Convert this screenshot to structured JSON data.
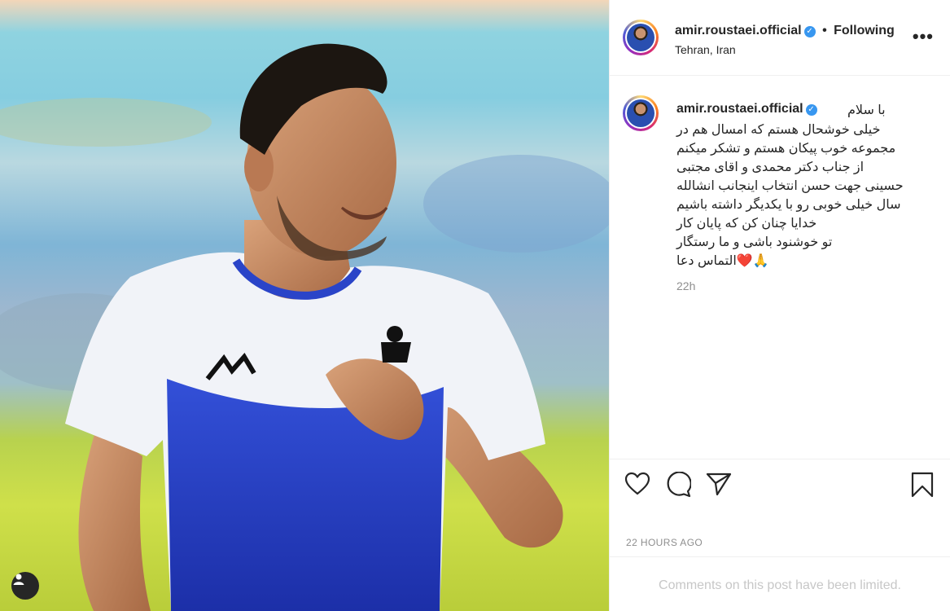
{
  "post": {
    "username": "amir.roustaei.official",
    "verified_mark": "✓",
    "separator": "•",
    "follow_status": "Following",
    "location": "Tehran, Iran",
    "more_label": "•••",
    "caption_first_line": "با سلام",
    "caption_body": "خیلی خوشحال هستم که امسال هم در\nمجموعه خوب پیکان هستم و تشکر میکنم\nاز جناب دکتر محمدی و اقای مجتبی\nحسینی جهت حسن انتخاب اینجانب انشالله\nسال خیلی خوبی رو با یکدیگر داشته باشیم\nخدایا چنان کن که پایان کار\nتو خوشنود باشی و ما رستگار\n🙏❤️التماس دعا",
    "caption_time": "22h",
    "timestamp": "22 HOURS AGO",
    "comments_notice": "Comments on this post have been limited."
  },
  "icons": {
    "like": "heart-icon",
    "comment": "comment-icon",
    "share": "send-icon",
    "save": "bookmark-icon",
    "tag": "user-tag-icon"
  },
  "colors": {
    "verified": "#3897f0",
    "text": "#262626",
    "muted": "#8e8e8e",
    "disabled": "#c7c7c7",
    "border": "#efefef"
  }
}
